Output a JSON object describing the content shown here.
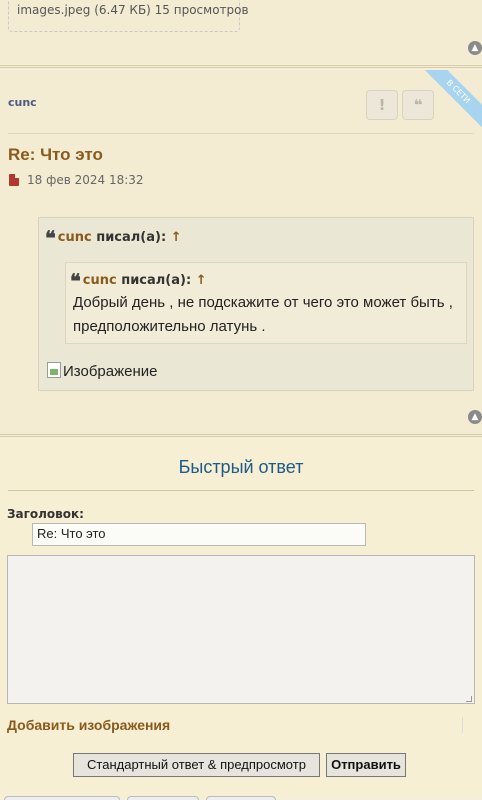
{
  "previous_post": {
    "attachment_caption": "images.jpeg (6.47 КБ) 15 просмотров"
  },
  "post": {
    "online_badge": "В СЕТИ",
    "author": "cunc",
    "report_icon_glyph": "!",
    "quote_icon_glyph": "❝",
    "title": "Re: Что это",
    "date": "18 фев 2024 18:32",
    "outer_quote": {
      "author": "cunc",
      "suffix": "писал(а):",
      "arrow": "↑"
    },
    "inner_quote": {
      "author": "cunc",
      "suffix": "писал(а):",
      "arrow": "↑",
      "text": "Добрый день , не подскажите от чего это может быть , предположительно латунь ."
    },
    "image_alt": "Изображение"
  },
  "quick_reply": {
    "title": "Быстрый ответ",
    "subject_label": "Заголовок:",
    "subject_value": "Re: Что это",
    "message_value": "",
    "add_images_label": "Добавить изображения",
    "preview_button": "Стандартный ответ & предпросмотр",
    "submit_button": "Отправить"
  },
  "colors": {
    "accent_brown": "#8a5a1c",
    "link_blue": "#1c5a8a",
    "online_badge": "#a8d4f0"
  }
}
